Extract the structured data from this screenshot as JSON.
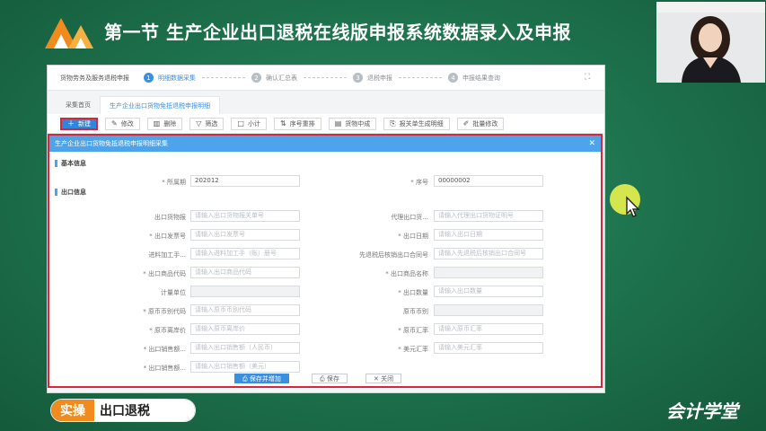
{
  "slide": {
    "title": "第一节 生产企业出口退税在线版申报系统数据录入及申报",
    "badge_tag": "实操",
    "badge_text": "出口退税",
    "brand": "会计学堂"
  },
  "app": {
    "crumb": "货物劳务及服务退税申报",
    "steps": [
      {
        "num": "1",
        "label": "明细数据采集"
      },
      {
        "num": "2",
        "label": "确认汇总表"
      },
      {
        "num": "3",
        "label": "退税申报"
      },
      {
        "num": "4",
        "label": "申报结果查询"
      }
    ],
    "tabs": [
      "采集首页",
      "生产企业出口货物免抵退税申报明细"
    ],
    "toolbar": {
      "new": "新建",
      "edit": "修改",
      "delete": "删除",
      "filter": "筛选",
      "subtotal": "小计",
      "reorder": "序号重排",
      "goods_check": "货物中成",
      "report_gen": "报关单生成明细",
      "batch_edit": "批量修改"
    }
  },
  "modal": {
    "title": "生产企业出口货物免抵退税申报明细采集",
    "section_basic": "基本信息",
    "section_export": "出口信息",
    "fields": {
      "period_label": "* 所属期",
      "period_value": "202012",
      "seq_label": "* 序号",
      "seq_value": "00000002",
      "goods_cert_label": "出口货物报",
      "goods_cert_ph": "请输入出口货物报关单号",
      "agent_cert_label": "代理出口货...",
      "agent_cert_ph": "请输入代理出口货物证明号",
      "invoice_label": "* 出口发票号",
      "invoice_ph": "请输入出口发票号",
      "export_date_label": "* 出口日期",
      "export_date_ph": "请输入出口日期",
      "processing_label": "进料加工手...",
      "processing_ph": "请输入进料加工手（账）册号",
      "contract_label": "先退税后核销出口合同号",
      "contract_ph": "请输入先退税后核销出口合同号",
      "product_code_label": "* 出口商品代码",
      "product_code_ph": "请输入出口商品代码",
      "product_name_label": "* 出口商品名称",
      "unit_label": "计量单位",
      "qty_label": "* 出口数量",
      "qty_ph": "请输入出口数量",
      "currency_code_label": "* 原币币别代码",
      "currency_code_ph": "请输入原币币别代码",
      "currency_label": "原币币别",
      "unit_price_label": "* 原币离岸价",
      "unit_price_ph": "请输入原币离岸价",
      "orig_amount_label": "* 原币汇率",
      "orig_amount_ph": "请输入原币汇率",
      "sales_rmb_label": "* 出口销售额...",
      "sales_rmb_ph": "请输入出口销售额（人民币）",
      "usd_label": "* 美元汇率",
      "usd_ph": "请输入美元汇率",
      "sales_usd_label": "* 出口销售额...",
      "sales_usd_ph": "请输入出口销售额（美元）"
    },
    "buttons": {
      "save_add": "保存并增加",
      "save": "保存",
      "close": "关闭"
    }
  },
  "colors": {
    "background": "#1f7550",
    "accent_blue": "#3b8fe0",
    "highlight_red": "#d6283a",
    "badge_orange": "#f28b1d"
  }
}
